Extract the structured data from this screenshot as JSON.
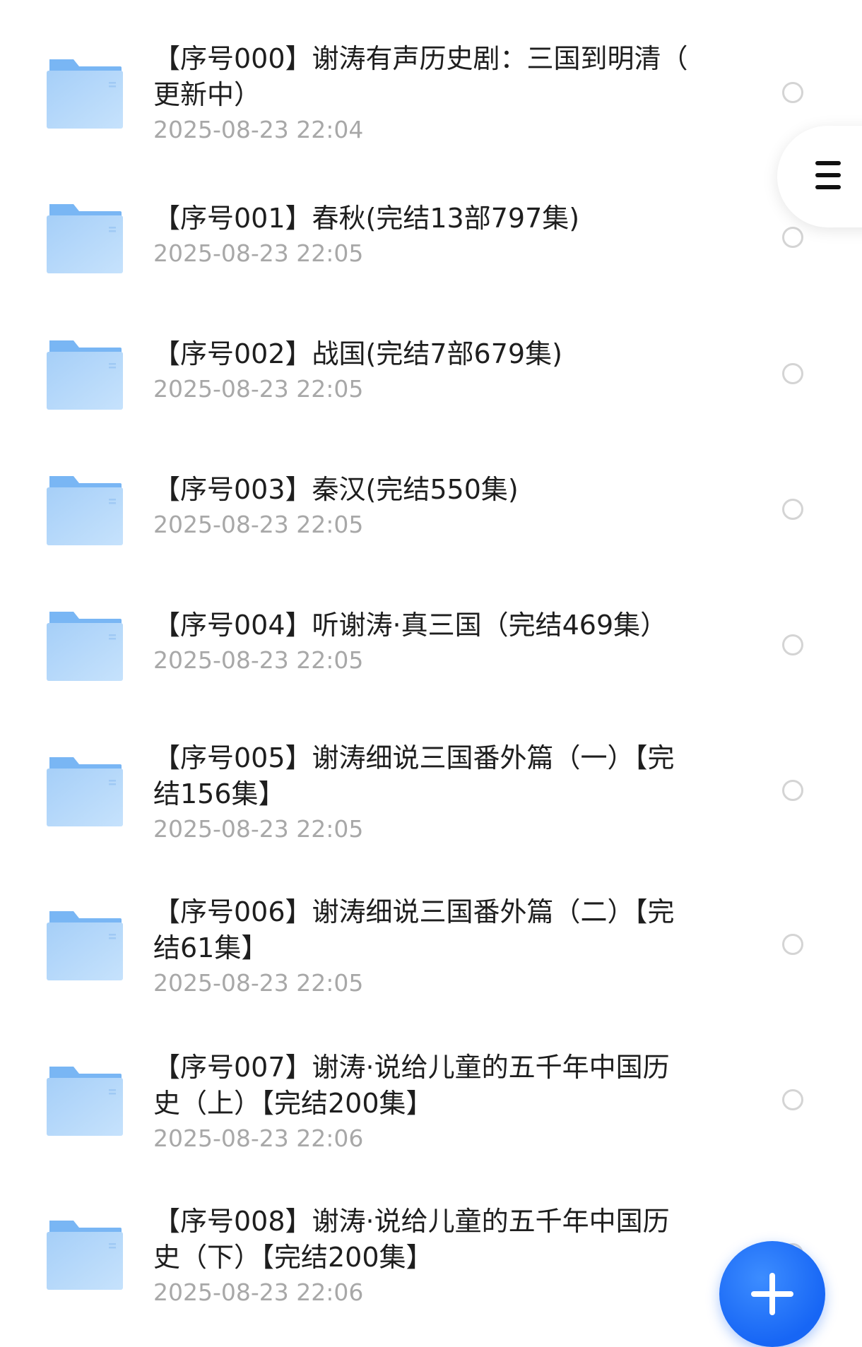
{
  "files": [
    {
      "title_lines": [
        "【序号000】谢涛有声历史剧：三国到明清（",
        "更新中）"
      ],
      "date": "2025-08-23 22:04",
      "selected": false
    },
    {
      "title_lines": [
        "【序号001】春秋(完结13部797集)"
      ],
      "date": "2025-08-23 22:05",
      "selected": false
    },
    {
      "title_lines": [
        "【序号002】战国(完结7部679集)"
      ],
      "date": "2025-08-23 22:05",
      "selected": false
    },
    {
      "title_lines": [
        "【序号003】秦汉(完结550集)"
      ],
      "date": "2025-08-23 22:05",
      "selected": false
    },
    {
      "title_lines": [
        "【序号004】听谢涛·真三国（完结469集）"
      ],
      "date": "2025-08-23 22:05",
      "selected": false
    },
    {
      "title_lines": [
        "【序号005】谢涛细说三国番外篇（一）【完",
        "结156集】"
      ],
      "date": "2025-08-23 22:05",
      "selected": false
    },
    {
      "title_lines": [
        "【序号006】谢涛细说三国番外篇（二）【完",
        "结61集】"
      ],
      "date": "2025-08-23 22:05",
      "selected": false
    },
    {
      "title_lines": [
        "【序号007】谢涛·说给儿童的五千年中国历",
        "史（上）【完结200集】"
      ],
      "date": "2025-08-23 22:06",
      "selected": false
    },
    {
      "title_lines": [
        "【序号008】谢涛·说给儿童的五千年中国历",
        "史（下）【完结200集】"
      ],
      "date": "2025-08-23 22:06",
      "selected": false
    }
  ],
  "icons": {
    "folder": "folder-icon",
    "menu": "menu-icon",
    "add": "plus-icon"
  },
  "colors": {
    "folder_light": "#b8dafb",
    "folder_dark": "#7ab8f5",
    "accent": "#1766f5",
    "date_text": "#a8a8a8"
  }
}
